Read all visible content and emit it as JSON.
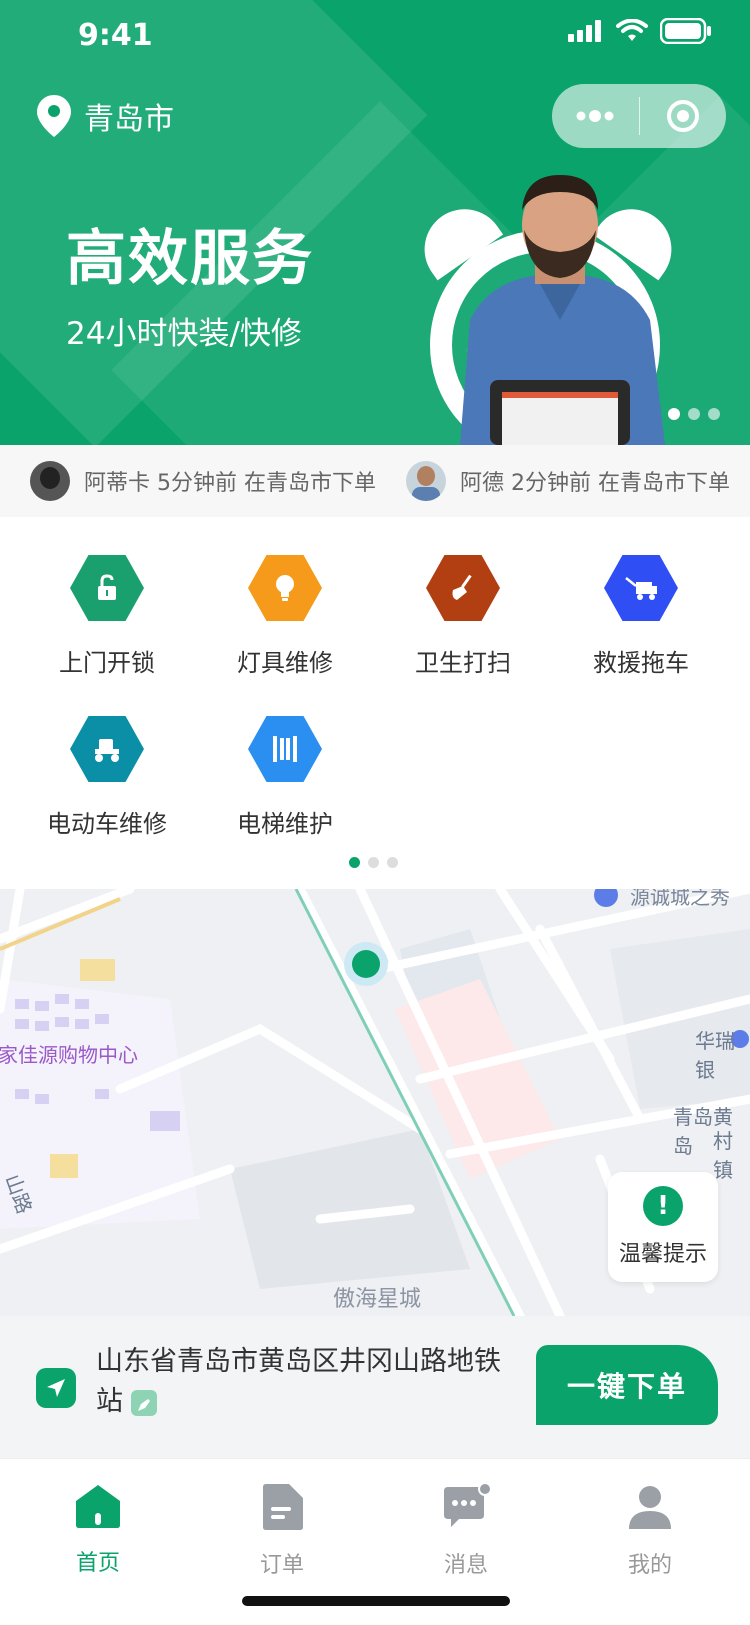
{
  "status": {
    "time": "9:41"
  },
  "location": {
    "city": "青岛市"
  },
  "banner": {
    "title": "高效服务",
    "subtitle": "24小时快装/快修",
    "dots": 3,
    "active_dot": 0
  },
  "ticker": [
    {
      "name": "阿蒂卡",
      "time": "5分钟前",
      "text": "在青岛市下单"
    },
    {
      "name": "阿德",
      "time": "2分钟前",
      "text": "在青岛市下单"
    }
  ],
  "services": [
    {
      "label": "上门开锁",
      "color": "#1aa06e",
      "icon": "unlock-icon"
    },
    {
      "label": "灯具维修",
      "color": "#f59a1a",
      "icon": "lightbulb-icon"
    },
    {
      "label": "卫生打扫",
      "color": "#b23f12",
      "icon": "broom-icon"
    },
    {
      "label": "救援拖车",
      "color": "#2f4ff4",
      "icon": "tow-truck-icon"
    },
    {
      "label": "电动车维修",
      "color": "#0b8fa6",
      "icon": "ebike-icon"
    },
    {
      "label": "电梯维护",
      "color": "#2a8ff0",
      "icon": "elevator-icon"
    }
  ],
  "map": {
    "labels": [
      "源诚城之秀",
      "家佳源购物中心",
      "华瑞银",
      "青岛黄岛",
      "村镇",
      "山路",
      "傲海星城"
    ]
  },
  "tip": {
    "label": "温馨提示"
  },
  "address": {
    "text": "山东省青岛市黄岛区井冈山路地铁站"
  },
  "order_button": {
    "label": "一键下单"
  },
  "tabbar": [
    {
      "label": "首页",
      "active": true
    },
    {
      "label": "订单",
      "active": false
    },
    {
      "label": "消息",
      "active": false
    },
    {
      "label": "我的",
      "active": false
    }
  ],
  "colors": {
    "primary": "#0aa36b"
  }
}
